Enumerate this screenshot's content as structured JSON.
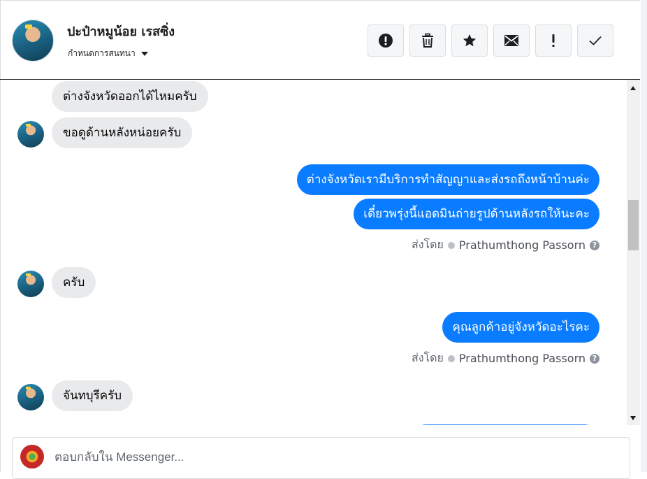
{
  "header": {
    "contact_name": "ปะป๋าหมูน้อย เรสซิ่ง",
    "assign_label": "กำหนดการสนทนา",
    "toolbar": [
      {
        "icon": "alert-circle-icon",
        "name": "mark-spam-button"
      },
      {
        "icon": "trash-icon",
        "name": "delete-button"
      },
      {
        "icon": "star-icon",
        "name": "star-button"
      },
      {
        "icon": "envelope-icon",
        "name": "mark-unread-button"
      },
      {
        "icon": "exclamation-icon",
        "name": "follow-up-button"
      },
      {
        "icon": "check-icon",
        "name": "mark-done-button"
      }
    ]
  },
  "messages": {
    "in_1": "ต่างจังหวัดออกได้ไหมครับ",
    "in_2": "ขอดูด้านหลังหน่อยครับ",
    "out_1": "ต่างจังหวัดเรามีบริการทำสัญญาและส่งรถถึงหน้าบ้านค่ะ",
    "out_2": "เดี๋ยวพรุ่งนี้แอดมินถ่ายรูปด้านหลังรถให้นะคะ",
    "sent_by_label_1": "ส่งโดย",
    "sent_by_name_1": "Prathumthong Passorn",
    "in_3": "ครับ",
    "out_3": "คุณลูกค้าอยู่จังหวัดอะไรคะ",
    "sent_by_label_2": "ส่งโดย",
    "sent_by_name_2": "Prathumthong Passorn",
    "in_4": "จันทบุรีครับ"
  },
  "composer": {
    "placeholder": "ตอบกลับใน Messenger..."
  },
  "colors": {
    "outgoing_bubble": "#0a7cff",
    "incoming_bubble": "#e9eaec"
  }
}
